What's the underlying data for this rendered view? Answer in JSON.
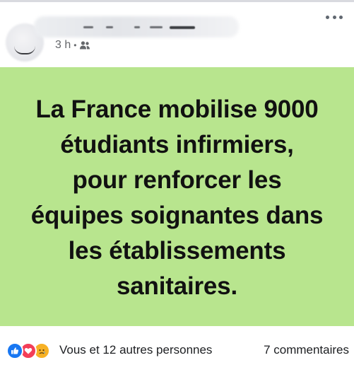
{
  "header": {
    "author_name": "",
    "timestamp": "3 h",
    "separator": "•",
    "audience_icon": "friends-icon",
    "more_icon": "more-options-icon"
  },
  "post": {
    "background_color": "#b8e58e",
    "text_lines": [
      "La France mobilise 9000",
      "étudiants infirmiers,",
      "pour renforcer les",
      "équipes soignantes dans",
      "les établissements",
      "sanitaires."
    ]
  },
  "footer": {
    "reaction_icons": [
      "like-icon",
      "love-icon",
      "sad-icon"
    ],
    "reaction_summary": "Vous et 12 autres personnes",
    "comments": "7 commentaires"
  },
  "colors": {
    "like": "#1877f2",
    "love": "#f33e58",
    "sad": "#f7b125",
    "meta_text": "#65676b"
  }
}
